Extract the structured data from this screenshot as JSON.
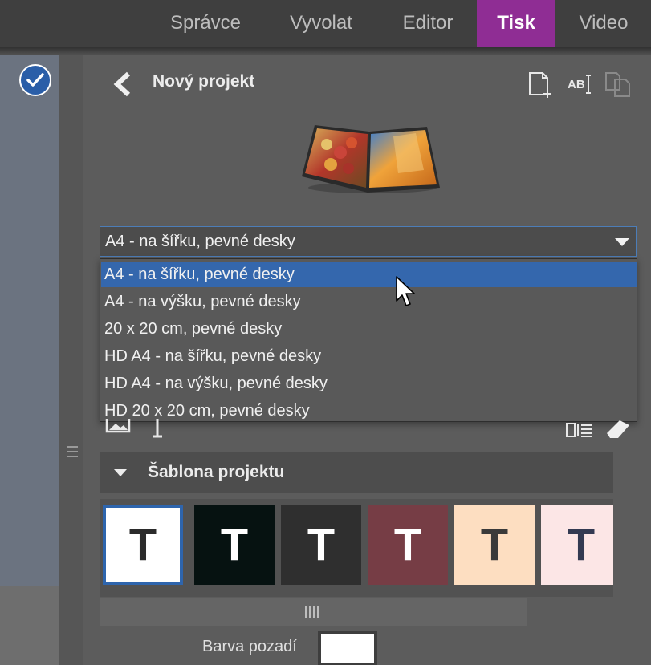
{
  "tabs": [
    {
      "label": "Správce",
      "active": false
    },
    {
      "label": "Vyvolat",
      "active": false
    },
    {
      "label": "Editor",
      "active": false
    },
    {
      "label": "Tisk",
      "active": true
    },
    {
      "label": "Video",
      "active": false
    }
  ],
  "colors": {
    "active_tab": "#8f2d94",
    "selection": "#3467ad",
    "panel": "#5c5c5c"
  },
  "panel": {
    "title": "Nový projekt",
    "header_icons": [
      "new-page-icon",
      "text-rename-icon",
      "duplicate-icon"
    ]
  },
  "project_select": {
    "value": "A4 - na šířku, pevné desky",
    "options": [
      "A4 - na šířku, pevné desky",
      "A4 - na výšku, pevné desky",
      "20 x 20 cm, pevné desky",
      "HD A4 - na šířku, pevné desky",
      "HD A4 - na výšku, pevné desky",
      "HD 20 x 20 cm, pevné desky"
    ],
    "highlighted_index": 0
  },
  "template_section": {
    "title": "Šablona projektu",
    "swatches": [
      {
        "letter": "T",
        "bg": "#ffffff",
        "fg": "#2b2b2b",
        "selected": true
      },
      {
        "letter": "T",
        "bg": "#061211",
        "fg": "#ffffff",
        "selected": false
      },
      {
        "letter": "T",
        "bg": "#2f2f2f",
        "fg": "#ffffff",
        "selected": false
      },
      {
        "letter": "T",
        "bg": "#763d45",
        "fg": "#ffffff",
        "selected": false
      },
      {
        "letter": "T",
        "bg": "#fddec1",
        "fg": "#3a3a3a",
        "selected": false
      },
      {
        "letter": "T",
        "bg": "#fce6e6",
        "fg": "#333a52",
        "selected": false
      }
    ]
  },
  "background": {
    "label": "Barva pozadí",
    "color": "#ffffff"
  }
}
